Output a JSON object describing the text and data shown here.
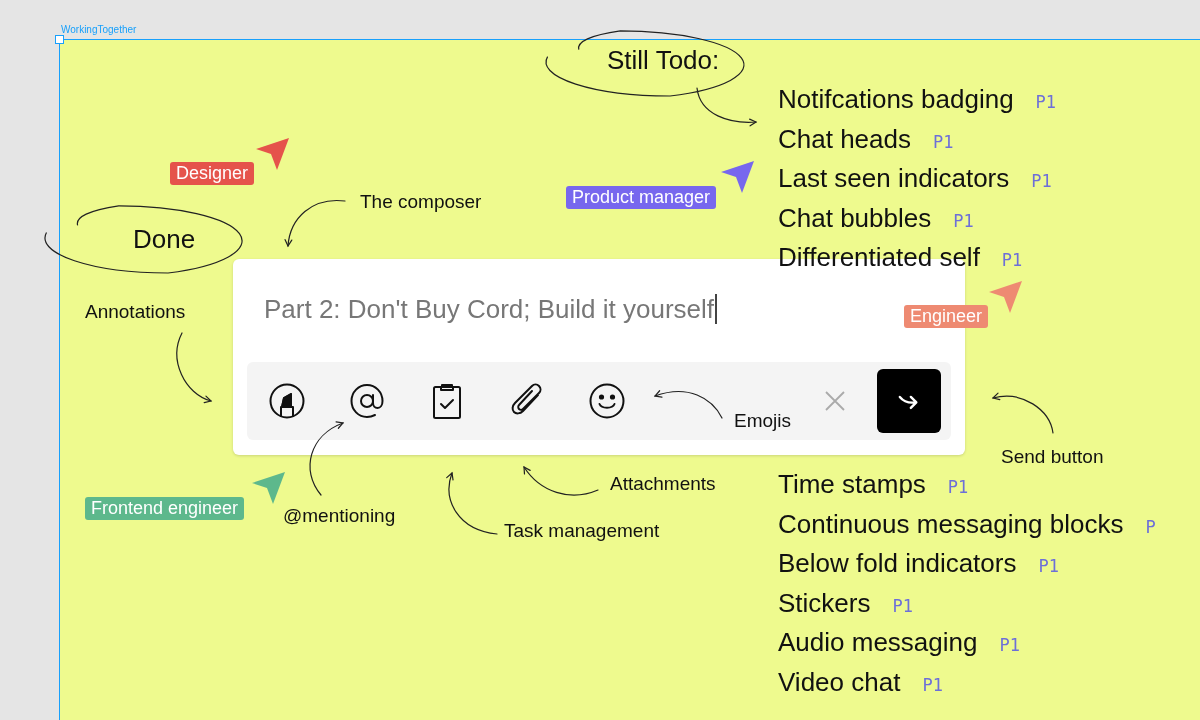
{
  "frame": {
    "title": "WorkingTogether"
  },
  "headings": [
    {
      "text": "Still Todo:"
    },
    {
      "text": "Done"
    }
  ],
  "annotations": [
    {
      "text": "The composer"
    },
    {
      "text": "Annotations"
    },
    {
      "text": "Emojis"
    },
    {
      "text": "Send button"
    },
    {
      "text": "Attachments"
    },
    {
      "text": "@mentioning"
    },
    {
      "text": "Task management"
    }
  ],
  "cursors": [
    {
      "label": "Designer",
      "color": "#e5534b"
    },
    {
      "label": "Product manager",
      "color": "#7767ee"
    },
    {
      "label": "Engineer",
      "color": "#ee8a72"
    },
    {
      "label": "Frontend engineer",
      "color": "#5db88c"
    }
  ],
  "todo_groups": [
    {
      "items": [
        {
          "label": "Notifcations badging",
          "priority": "P1"
        },
        {
          "label": "Chat heads",
          "priority": "P1"
        },
        {
          "label": "Last seen indicators",
          "priority": "P1"
        },
        {
          "label": "Chat bubbles",
          "priority": "P1"
        },
        {
          "label": "Differentiated self",
          "priority": "P1"
        }
      ]
    },
    {
      "items": [
        {
          "label": "Time stamps",
          "priority": "P1"
        },
        {
          "label": "Continuous messaging blocks",
          "priority": "P"
        },
        {
          "label": "Below fold indicators",
          "priority": "P1"
        },
        {
          "label": "Stickers",
          "priority": "P1"
        },
        {
          "label": "Audio messaging",
          "priority": "P1"
        },
        {
          "label": "Video chat",
          "priority": "P1"
        }
      ]
    }
  ],
  "composer": {
    "value": "Part 2: Don't Buy Cord; Build it yourself"
  }
}
